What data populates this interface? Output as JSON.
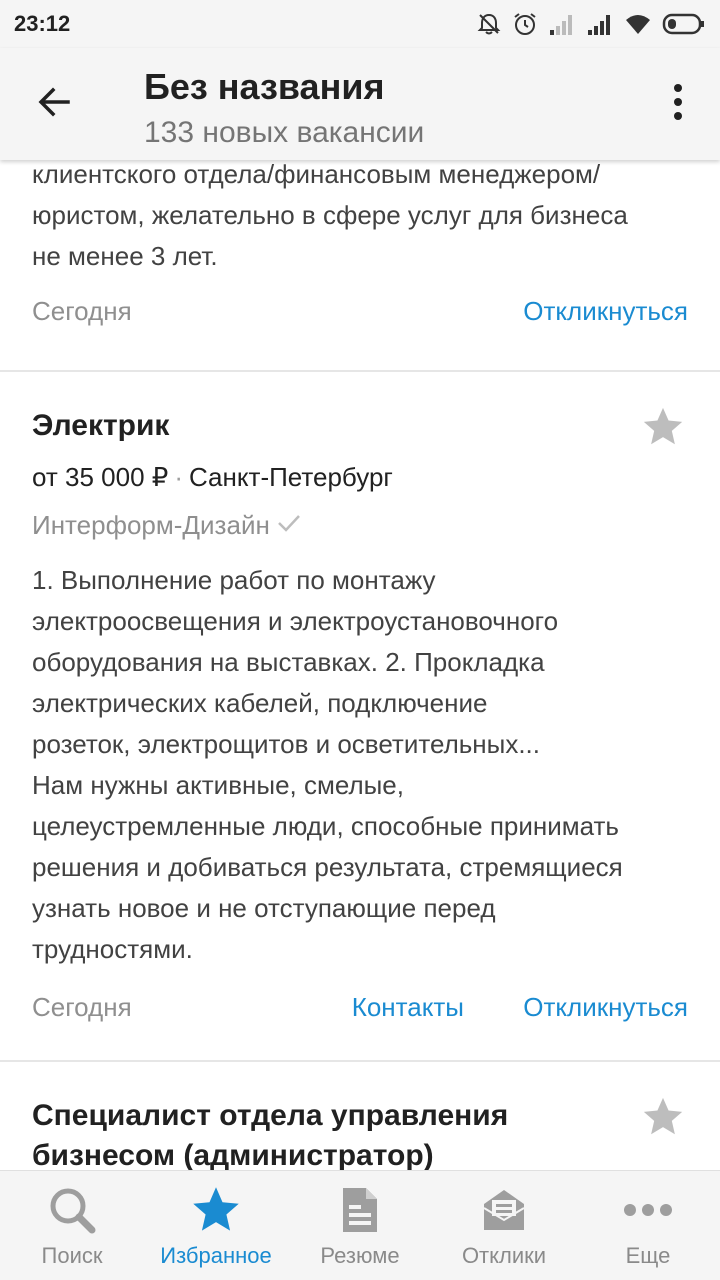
{
  "status_bar": {
    "time": "23:12"
  },
  "app_bar": {
    "title": "Без названия",
    "subtitle": "133 новых вакансии"
  },
  "colors": {
    "accent": "#1a8bd1",
    "star_inactive": "#bdbdbd",
    "muted_text": "#8f8f8f"
  },
  "cards": [
    {
      "description_lines": [
        "клиентского отдела/финансовым менеджером/",
        "юристом, желательно в сфере услуг для бизнеса",
        "не менее 3 лет."
      ],
      "date": "Сегодня",
      "respond_label": "Откликнуться"
    },
    {
      "title": "Электрик",
      "salary": "от 35 000 ₽",
      "separator": "·",
      "city": "Санкт-Петербург",
      "company": "Интерформ-Дизайн",
      "description_lines": [
        "1. Выполнение работ по монтажу",
        "электроосвещения и электроустановочного",
        "оборудования на выставках. 2. Прокладка",
        "электрических кабелей, подключение",
        "розеток, электрощитов и осветительных...",
        "Нам нужны активные, смелые,",
        "целеустремленные люди, способные принимать",
        "решения и добиваться результата, стремящиеся",
        "узнать новое и не отступающие перед",
        "трудностями."
      ],
      "date": "Сегодня",
      "contacts_label": "Контакты",
      "respond_label": "Откликнуться"
    },
    {
      "title_lines": [
        "Специалист отдела управления",
        "бизнесом (администратор)"
      ]
    }
  ],
  "bottom_nav": [
    {
      "label": "Поиск",
      "icon": "search-icon",
      "active": false
    },
    {
      "label": "Избранное",
      "icon": "star-icon",
      "active": true
    },
    {
      "label": "Резюме",
      "icon": "document-icon",
      "active": false
    },
    {
      "label": "Отклики",
      "icon": "envelope-icon",
      "active": false
    },
    {
      "label": "Еще",
      "icon": "more-horizontal-icon",
      "active": false
    }
  ]
}
